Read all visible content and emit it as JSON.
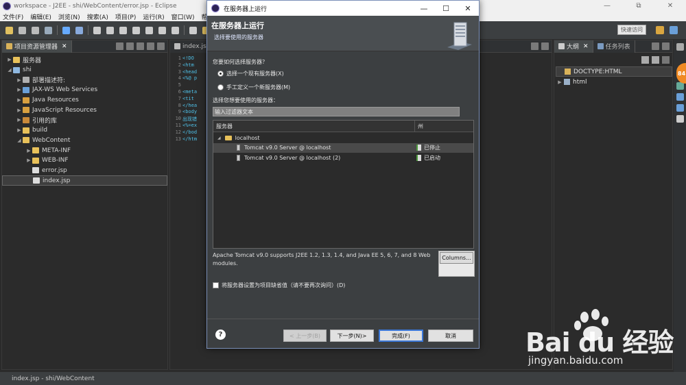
{
  "window": {
    "title": "workspace - J2EE - shi/WebContent/error.jsp - Eclipse",
    "controls": [
      "—",
      "⧉",
      "✕"
    ]
  },
  "menu": [
    "文件(F)",
    "编辑(E)",
    "浏览(N)",
    "搜索(A)",
    "项目(P)",
    "运行(R)",
    "窗口(W)",
    "帮助"
  ],
  "toolbar": {
    "quick_access": "快速访问"
  },
  "project_explorer": {
    "tab_label": "项目资源管理器",
    "tree": [
      {
        "label": "服务器",
        "depth": 0,
        "arrow": "▶",
        "icon": "folder-icon",
        "color": "#e8c15a"
      },
      {
        "label": "shi",
        "depth": 0,
        "arrow": "◢",
        "icon": "project-icon",
        "color": "#8fb8e0"
      },
      {
        "label": "部署描述符:",
        "depth": 1,
        "arrow": "▶",
        "icon": "descriptor-icon",
        "color": "#b0b0b0"
      },
      {
        "label": "JAX-WS Web Services",
        "depth": 1,
        "arrow": "▶",
        "icon": "webservice-icon",
        "color": "#6aa0d8"
      },
      {
        "label": "Java Resources",
        "depth": 1,
        "arrow": "▶",
        "icon": "java-resources-icon",
        "color": "#d8a040"
      },
      {
        "label": "JavaScript Resources",
        "depth": 1,
        "arrow": "▶",
        "icon": "js-resources-icon",
        "color": "#d8a040"
      },
      {
        "label": "引用的库",
        "depth": 1,
        "arrow": "▶",
        "icon": "library-icon",
        "color": "#c98a3a"
      },
      {
        "label": "build",
        "depth": 1,
        "arrow": "▶",
        "icon": "folder-icon",
        "color": "#e8c15a"
      },
      {
        "label": "WebContent",
        "depth": 1,
        "arrow": "◢",
        "icon": "folder-icon",
        "color": "#e8c15a"
      },
      {
        "label": "META-INF",
        "depth": 2,
        "arrow": "▶",
        "icon": "folder-icon",
        "color": "#e8c15a"
      },
      {
        "label": "WEB-INF",
        "depth": 2,
        "arrow": "▶",
        "icon": "folder-icon",
        "color": "#e8c15a"
      },
      {
        "label": "error.jsp",
        "depth": 2,
        "arrow": "",
        "icon": "jsp-file-icon",
        "color": "#dcdcdc"
      },
      {
        "label": "index.jsp",
        "depth": 2,
        "arrow": "",
        "icon": "jsp-file-icon",
        "color": "#dcdcdc",
        "selected": true
      }
    ]
  },
  "editor": {
    "tab_label": "index.jsp",
    "lines": [
      {
        "n": "1",
        "text": "<!DO"
      },
      {
        "n": "2",
        "text": "<htm"
      },
      {
        "n": "3",
        "text": "<head"
      },
      {
        "n": "4",
        "text": "<%@ p"
      },
      {
        "n": "5",
        "text": ""
      },
      {
        "n": "6",
        "text": "<meta"
      },
      {
        "n": "7",
        "text": "<tit"
      },
      {
        "n": "8",
        "text": "</hea"
      },
      {
        "n": "9",
        "text": "<body"
      },
      {
        "n": "10",
        "text": "出现错"
      },
      {
        "n": "11",
        "text": "<%=ex"
      },
      {
        "n": "12",
        "text": "</bod"
      },
      {
        "n": "13",
        "text": "</htm"
      }
    ]
  },
  "outline": {
    "tab_label": "大纲",
    "tab2_label": "任务列表",
    "rows": [
      {
        "label": "DOCTYPE:HTML",
        "arrow": ""
      },
      {
        "label": "html",
        "arrow": "▶"
      }
    ]
  },
  "dialog": {
    "title": "在服务器上运行",
    "banner_title": "在服务器上运行",
    "banner_subtitle": "选择要使用的服务器",
    "question": "您要如何选择服务器？",
    "radio_existing": "选择一个现有服务器(X)",
    "radio_new": "手工定义一个新服务器(M)",
    "select_label": "选择您想要使用的服务器：",
    "filter_placeholder": "输入过滤器文本",
    "table": {
      "col_server": "服务器",
      "col_state": "州",
      "rows": [
        {
          "name": "localhost",
          "state": "",
          "type": "group"
        },
        {
          "name": "Tomcat v9.0 Server @ localhost",
          "state": "已停止",
          "type": "server",
          "selected": true
        },
        {
          "name": "Tomcat v9.0 Server @ localhost (2)",
          "state": "已启动",
          "type": "server"
        }
      ]
    },
    "description": "Apache Tomcat v9.0 supports J2EE 1.2, 1.3, 1.4, and Java EE 5, 6, 7, and 8 Web modules.",
    "columns_button": "Columns...",
    "default_checkbox": "将服务器设置为项目缺省值（请不要再次询问）(D)",
    "help": "?",
    "btn_back": "< 上一步(B)",
    "btn_next": "下一步(N)>",
    "btn_finish": "完成(F)",
    "btn_cancel": "取消"
  },
  "status_bar": {
    "text": "index.jsp - shi/WebContent"
  },
  "side_badge": "84",
  "watermark": {
    "logo": "Bai du 经验",
    "url": "jingyan.baidu.com"
  }
}
